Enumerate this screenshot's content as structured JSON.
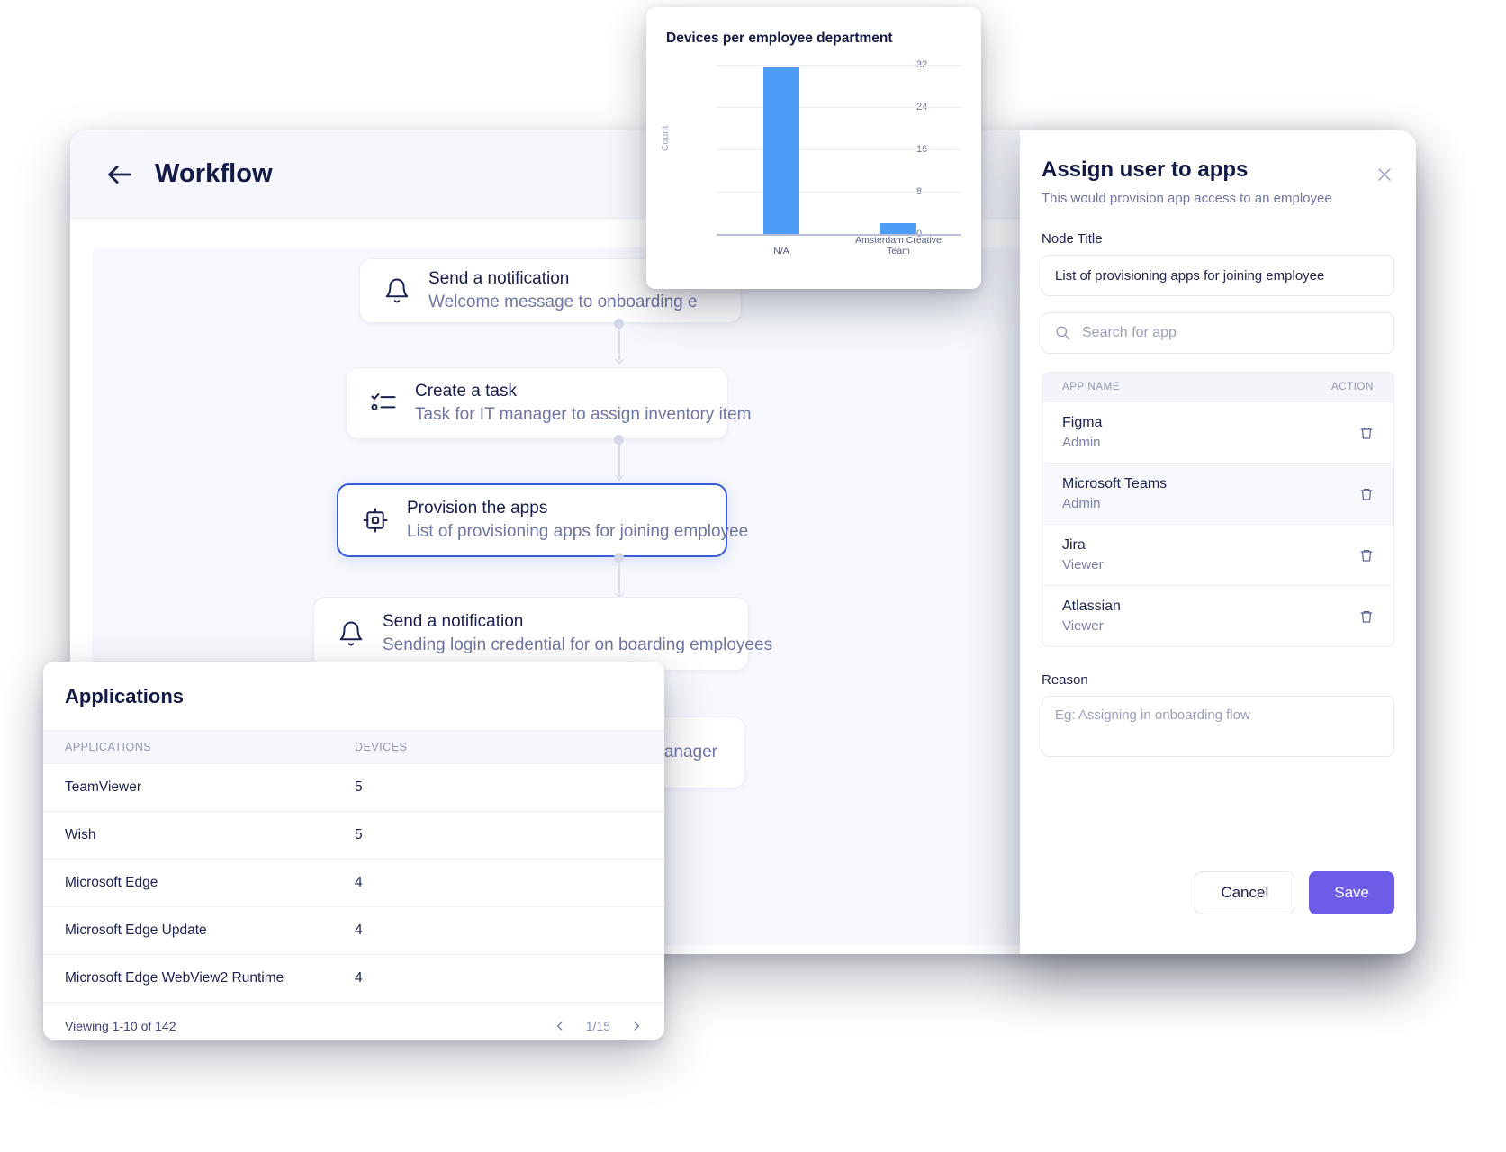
{
  "workflow": {
    "title": "Workflow",
    "back_icon": "arrow-left-icon",
    "nodes": [
      {
        "title": "Send a notification",
        "sub": "Welcome message to onboarding e",
        "icon": "bell-icon",
        "selected": false
      },
      {
        "title": "Create a task",
        "sub": "Task for IT manager to assign inventory item",
        "icon": "checklist-icon",
        "selected": false
      },
      {
        "title": "Provision the apps",
        "sub": "List of provisioning apps for joining employee",
        "icon": "chip-icon",
        "selected": true
      },
      {
        "title": "Send a notification",
        "sub": "Sending login credential for on boarding employees",
        "icon": "bell-icon",
        "selected": false
      },
      {
        "title": "",
        "sub": "IT manager",
        "icon": "",
        "selected": false
      }
    ]
  },
  "chart_card": {
    "title": "Devices per employee department"
  },
  "chart_data": {
    "type": "bar",
    "title": "Devices per employee department",
    "categories": [
      "N/A",
      "Amsterdam Creative Team"
    ],
    "values": [
      31,
      2
    ],
    "xlabel": "",
    "ylabel": "Count",
    "ylim": [
      0,
      32
    ],
    "yticks": [
      0,
      8,
      16,
      24,
      32
    ],
    "grid": true,
    "legend": "none",
    "bar_color": "#4d9cf5"
  },
  "applications_card": {
    "title": "Applications",
    "columns": [
      "APPLICATIONS",
      "DEVICES"
    ],
    "rows": [
      {
        "application": "TeamViewer",
        "devices": "5"
      },
      {
        "application": "Wish",
        "devices": "5"
      },
      {
        "application": "Microsoft Edge",
        "devices": "4"
      },
      {
        "application": "Microsoft Edge Update",
        "devices": "4"
      },
      {
        "application": "Microsoft Edge WebView2 Runtime",
        "devices": "4"
      }
    ],
    "footer": {
      "viewing": "Viewing 1-10 of 142",
      "page": "1/15",
      "prev_icon": "chevron-left-icon",
      "next_icon": "chevron-right-icon"
    }
  },
  "drawer": {
    "title": "Assign user to apps",
    "subtitle": "This would provision app access to an employee",
    "close_icon": "close-icon",
    "node_title_label": "Node Title",
    "node_title_value": "List of provisioning apps for joining employee",
    "search_placeholder": "Search for app",
    "search_icon": "search-icon",
    "table": {
      "col_name": "APP NAME",
      "col_action": "ACTION",
      "rows": [
        {
          "name": "Figma",
          "role": "Admin",
          "action_icon": "trash-icon"
        },
        {
          "name": "Microsoft Teams",
          "role": "Admin",
          "action_icon": "trash-icon"
        },
        {
          "name": "Jira",
          "role": "Viewer",
          "action_icon": "trash-icon"
        },
        {
          "name": "Atlassian",
          "role": "Viewer",
          "action_icon": "trash-icon"
        }
      ]
    },
    "reason_label": "Reason",
    "reason_placeholder": "Eg: Assigning in onboarding flow",
    "cancel_label": "Cancel",
    "save_label": "Save",
    "save_color": "#6c5ce7"
  }
}
